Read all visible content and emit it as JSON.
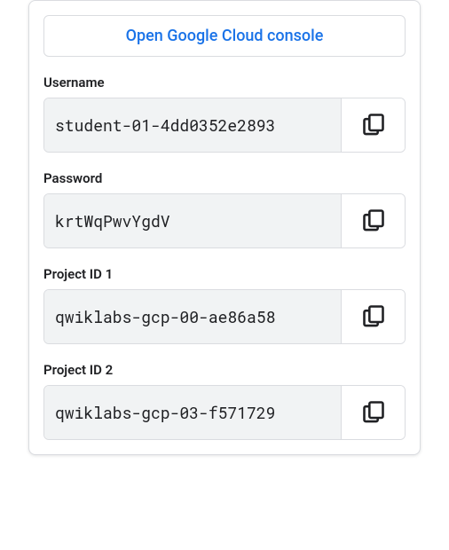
{
  "console_button_label": "Open Google Cloud console",
  "fields": [
    {
      "label": "Username",
      "value": "student-01-4dd0352e2893"
    },
    {
      "label": "Password",
      "value": "krtWqPwvYgdV"
    },
    {
      "label": "Project ID 1",
      "value": "qwiklabs-gcp-00-ae86a58"
    },
    {
      "label": "Project ID 2",
      "value": "qwiklabs-gcp-03-f571729"
    }
  ]
}
